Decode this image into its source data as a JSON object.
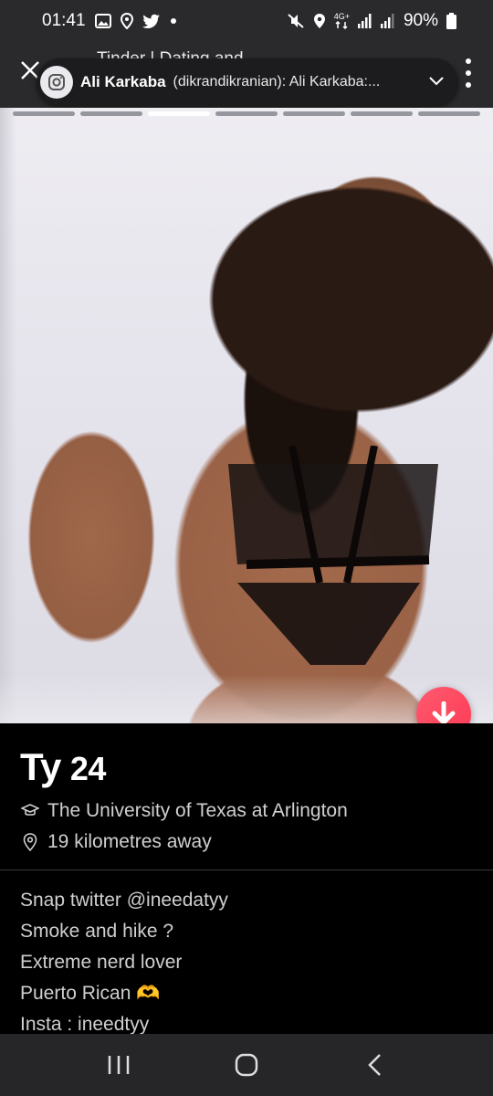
{
  "status_bar": {
    "time": "01:41",
    "battery": "90%",
    "network": "4G+",
    "icons": [
      "gallery-icon",
      "location-icon",
      "twitter-icon",
      "dot-icon",
      "mute-icon",
      "location-icon",
      "data-arrows-icon",
      "signal-icon",
      "signal-icon",
      "battery-icon"
    ]
  },
  "top_bar": {
    "behind_title": "Tinder | Dating and",
    "close_icon": "close-icon",
    "menu_icon": "more-vertical-icon"
  },
  "notification": {
    "app_icon": "instagram-icon",
    "sender": "Ali Karkaba",
    "text": "(dikrandikranian): Ali Karkaba:...",
    "expand_icon": "chevron-down-icon"
  },
  "photo": {
    "progress": {
      "total": 7,
      "active_index": 2
    }
  },
  "profile": {
    "name": "Ty",
    "age": "24",
    "school": "The University of Texas at Arlington",
    "distance": "19 kilometres away",
    "bio_lines": [
      "Snap twitter @ineedatyy",
      "Smoke and hike ?",
      "Extreme nerd lover",
      "Puerto Rican 🫶",
      "Insta : ineedtyy"
    ]
  },
  "actions": {
    "collapse_icon": "arrow-down-icon",
    "accent": "#fd3a55"
  },
  "nav_bar": {
    "recents_icon": "recents-icon",
    "home_icon": "home-icon",
    "back_icon": "back-icon"
  }
}
